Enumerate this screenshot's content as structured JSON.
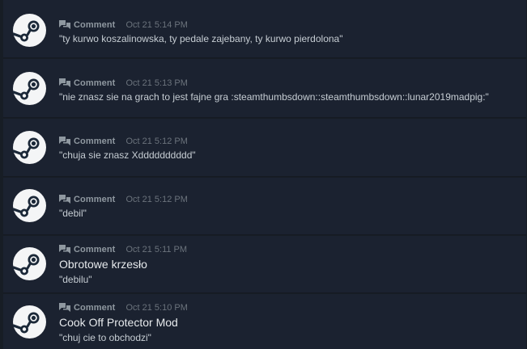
{
  "items": [
    {
      "type_label": "Comment",
      "time": "Oct 21 5:14 PM",
      "title": "",
      "text": "\"ty kurwo koszalinowska, ty pedale zajebany, ty kurwo pierdolona\""
    },
    {
      "type_label": "Comment",
      "time": "Oct 21 5:13 PM",
      "title": "",
      "text": "\"nie znasz sie na grach to jest fajne gra :steamthumbsdown::steamthumbsdown::lunar2019madpig:\""
    },
    {
      "type_label": "Comment",
      "time": "Oct 21 5:12 PM",
      "title": "",
      "text": "\"chuja sie znasz Xdddddddddd\""
    },
    {
      "type_label": "Comment",
      "time": "Oct 21 5:12 PM",
      "title": "",
      "text": "\"debil\""
    },
    {
      "type_label": "Comment",
      "time": "Oct 21 5:11 PM",
      "title": "Obrotowe krzesło",
      "text": "\"debilu\""
    },
    {
      "type_label": "Comment",
      "time": "Oct 21 5:10 PM",
      "title": "Cook Off Protector Mod",
      "text": "\"chuj cie to obchodzi\""
    }
  ],
  "icons": {
    "avatar": "steam-logo-icon",
    "type": "comment-icon"
  },
  "colors": {
    "background": "#171d25",
    "row": "#1b2230",
    "label": "#8f98a0",
    "time": "#6b737c",
    "title": "#e6e9ec",
    "text": "#c6cdd3"
  }
}
